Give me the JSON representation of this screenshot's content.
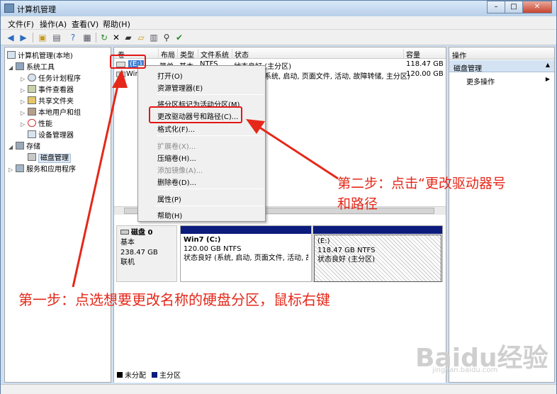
{
  "window": {
    "title": "计算机管理",
    "buttons": {
      "minimize": "–",
      "maximize": "□",
      "close": "✕"
    }
  },
  "menu": [
    "文件(F)",
    "操作(A)",
    "查看(V)",
    "帮助(H)"
  ],
  "toolbar_icons": [
    "back-icon",
    "forward-icon",
    "up-folder-icon",
    "console-tree-icon",
    "help-icon",
    "properties-icon",
    "refresh-icon",
    "delete-icon",
    "export-icon",
    "open-folder-icon",
    "help-book-icon",
    "search-icon",
    "check-icon"
  ],
  "tree": [
    {
      "label": "计算机管理(本地)",
      "icon": "computer-icon",
      "depth": 0,
      "arrow": ""
    },
    {
      "label": "系统工具",
      "icon": "tools-icon",
      "depth": 1,
      "arrow": "◢"
    },
    {
      "label": "任务计划程序",
      "icon": "clock-icon",
      "depth": 2,
      "arrow": "▷"
    },
    {
      "label": "事件查看器",
      "icon": "event-viewer-icon",
      "depth": 2,
      "arrow": "▷"
    },
    {
      "label": "共享文件夹",
      "icon": "shared-folder-icon",
      "depth": 2,
      "arrow": "▷"
    },
    {
      "label": "本地用户和组",
      "icon": "users-icon",
      "depth": 2,
      "arrow": "▷"
    },
    {
      "label": "性能",
      "icon": "performance-icon",
      "depth": 2,
      "arrow": "▷"
    },
    {
      "label": "设备管理器",
      "icon": "device-manager-icon",
      "depth": 2,
      "arrow": ""
    },
    {
      "label": "存储",
      "icon": "storage-icon",
      "depth": 1,
      "arrow": "◢"
    },
    {
      "label": "磁盘管理",
      "icon": "disk-icon",
      "depth": 2,
      "arrow": "",
      "selected": true
    },
    {
      "label": "服务和应用程序",
      "icon": "services-icon",
      "depth": 1,
      "arrow": "▷"
    }
  ],
  "volume_table": {
    "headers": [
      "卷",
      "布局",
      "类型",
      "文件系统",
      "状态",
      "容量"
    ],
    "rows": [
      {
        "vol": "(E:)",
        "layout": "简单",
        "type": "基本",
        "fs": "NTFS",
        "status": "状态良好 (主分区)",
        "capacity": "118.47 GB"
      },
      {
        "vol": "Win",
        "layout": "",
        "type": "",
        "fs": "",
        "status": "系统, 启动, 页面文件, 活动, 故障转储, 主分区)",
        "capacity": "120.00 GB"
      }
    ]
  },
  "disk": {
    "name": "磁盘 0",
    "type": "基本",
    "size": "238.47 GB",
    "state": "联机",
    "partitions": [
      {
        "name": "Win7  (C:)",
        "size": "120.00 GB NTFS",
        "status": "状态良好 (系统, 启动, 页面文件, 活动, 故障"
      },
      {
        "name": "(E:)",
        "size": "118.47 GB NTFS",
        "status": "状态良好 (主分区)"
      }
    ]
  },
  "legend": [
    {
      "label": "未分配",
      "color": "#000000"
    },
    {
      "label": "主分区",
      "color": "#0c1c7c"
    }
  ],
  "actions": {
    "header": "操作",
    "section": "磁盘管理",
    "more": "更多操作"
  },
  "context_menu": [
    {
      "label": "打开(O)",
      "disabled": false
    },
    {
      "label": "资源管理器(E)",
      "disabled": false
    },
    {
      "sep": true
    },
    {
      "label": "将分区标记为活动分区(M)",
      "disabled": false
    },
    {
      "label": "更改驱动器号和路径(C)...",
      "disabled": false
    },
    {
      "label": "格式化(F)...",
      "disabled": false
    },
    {
      "sep": true
    },
    {
      "label": "扩展卷(X)...",
      "disabled": true
    },
    {
      "label": "压缩卷(H)...",
      "disabled": false
    },
    {
      "label": "添加镜像(A)...",
      "disabled": true
    },
    {
      "label": "删除卷(D)...",
      "disabled": false
    },
    {
      "sep": true
    },
    {
      "label": "属性(P)",
      "disabled": false
    },
    {
      "sep": true
    },
    {
      "label": "帮助(H)",
      "disabled": false
    }
  ],
  "annotations": {
    "step1": "第一步：点选想要更改名称的硬盘分区，鼠标右键",
    "step2_line1": "第二步：点击“更改驱动器号",
    "step2_line2": "和路径"
  },
  "watermark": {
    "text": "Baidu经验",
    "url": "jingyan.baidu.com"
  },
  "colors": {
    "annotation": "#e5281a",
    "primary_partition": "#0c1c7c"
  }
}
